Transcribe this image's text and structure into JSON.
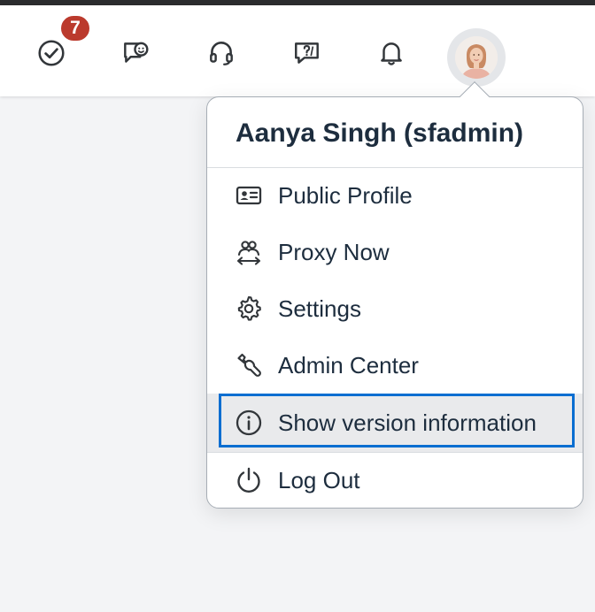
{
  "shellbar": {
    "tasks_badge": "7",
    "icons": [
      "check-circle-icon",
      "feedback-chat-icon",
      "headset-icon",
      "help-chat-icon",
      "bell-icon"
    ]
  },
  "user_menu": {
    "title": "Aanya Singh (sfadmin)",
    "items": [
      {
        "label": "Public Profile",
        "icon": "id-card-icon"
      },
      {
        "label": "Proxy Now",
        "icon": "proxy-users-icon"
      },
      {
        "label": "Settings",
        "icon": "gear-icon"
      },
      {
        "label": "Admin Center",
        "icon": "wrench-icon"
      },
      {
        "label": "Show version information",
        "icon": "info-icon"
      },
      {
        "label": "Log Out",
        "icon": "power-icon"
      }
    ]
  },
  "colors": {
    "accent": "#0a6ed1",
    "badge": "#bb3a2d",
    "text": "#1d2d3e",
    "icon": "#32363a"
  }
}
